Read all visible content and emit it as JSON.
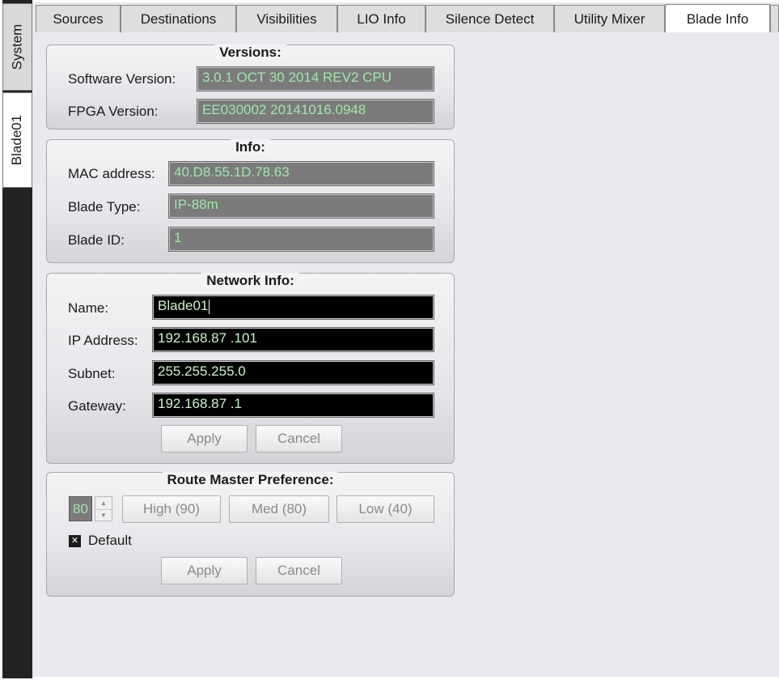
{
  "side_tabs": [
    {
      "label": "System"
    },
    {
      "label": "Blade01",
      "active": true
    }
  ],
  "tabs": [
    {
      "label": "Sources"
    },
    {
      "label": "Destinations"
    },
    {
      "label": "Visibilities"
    },
    {
      "label": "LIO Info"
    },
    {
      "label": "Silence Detect"
    },
    {
      "label": "Utility Mixer"
    },
    {
      "label": "Blade Info",
      "active": true
    }
  ],
  "versions": {
    "title": "Versions:",
    "software_label": "Software Version:",
    "software_value": "3.0.1  OCT 30 2014 REV2 CPU",
    "fpga_label": "FPGA Version:",
    "fpga_value": "EE030002 20141016.0948"
  },
  "info": {
    "title": "Info:",
    "mac_label": "MAC address:",
    "mac_value": "40.D8.55.1D.78.63",
    "type_label": "Blade Type:",
    "type_value": "IP-88m",
    "id_label": "Blade ID:",
    "id_value": "1"
  },
  "network": {
    "title": "Network Info:",
    "name_label": "Name:",
    "name_value": "Blade01",
    "ip_label": "IP Address:",
    "ip_value": "192.168.87 .101",
    "subnet_label": "Subnet:",
    "subnet_value": "255.255.255.0",
    "gateway_label": "Gateway:",
    "gateway_value": "192.168.87 .1",
    "apply_label": "Apply",
    "cancel_label": "Cancel"
  },
  "route": {
    "title": "Route Master Preference:",
    "spin_value": "80",
    "high_label": "High (90)",
    "med_label": "Med (80)",
    "low_label": "Low (40)",
    "default_checked": true,
    "default_label": "Default",
    "apply_label": "Apply",
    "cancel_label": "Cancel"
  },
  "colors": {
    "field_text": "#9ee8a6",
    "readonly_bg": "#7b7b7b",
    "editable_bg": "#000000",
    "sidebar_bg": "#232323"
  },
  "icons": {
    "spin_up": "chevron-up-icon",
    "spin_down": "chevron-down-icon",
    "checkbox": "check-x-icon"
  }
}
